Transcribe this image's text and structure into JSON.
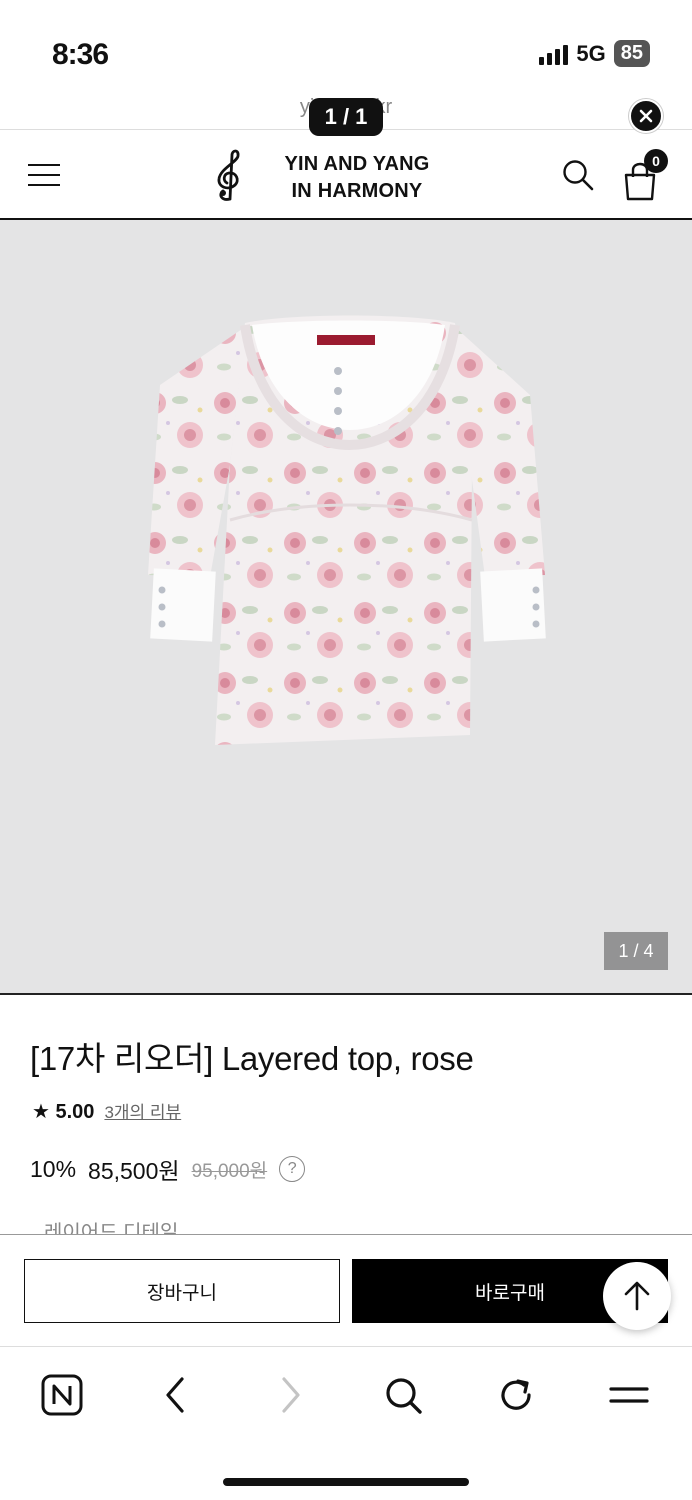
{
  "status": {
    "time": "8:36",
    "network": "5G",
    "battery": "85"
  },
  "browser": {
    "url": "yinar     co.kr",
    "page_counter": "1 / 1"
  },
  "header": {
    "logo_line1": "YIN AND YANG",
    "logo_line2": "IN HARMONY",
    "cart_count": "0"
  },
  "product": {
    "image_counter": "1 / 4",
    "title": "[17차 리오더] Layered top, rose",
    "rating_star": "★",
    "rating": "5.00",
    "review_link": "3개의 리뷰",
    "discount": "10%",
    "price": "85,500원",
    "original_price": "95,000원",
    "help": "?",
    "cutoff_text": "레이어드 디테일"
  },
  "actions": {
    "cart_label": "장바구니",
    "buy_label": "바로구매"
  },
  "icons": {
    "menu": "hamburger-menu-icon",
    "logo": "treble-clef-icon",
    "search": "search-icon",
    "cart": "shopping-bag-icon",
    "close": "close-icon",
    "scroll_top": "arrow-up-icon",
    "nav": [
      "naver-home-icon",
      "back-icon",
      "forward-icon",
      "search-icon",
      "refresh-icon",
      "menu-icon"
    ]
  },
  "colors": {
    "image_bg": "#e4e4e5",
    "accent": "#000000",
    "muted": "#999999"
  }
}
